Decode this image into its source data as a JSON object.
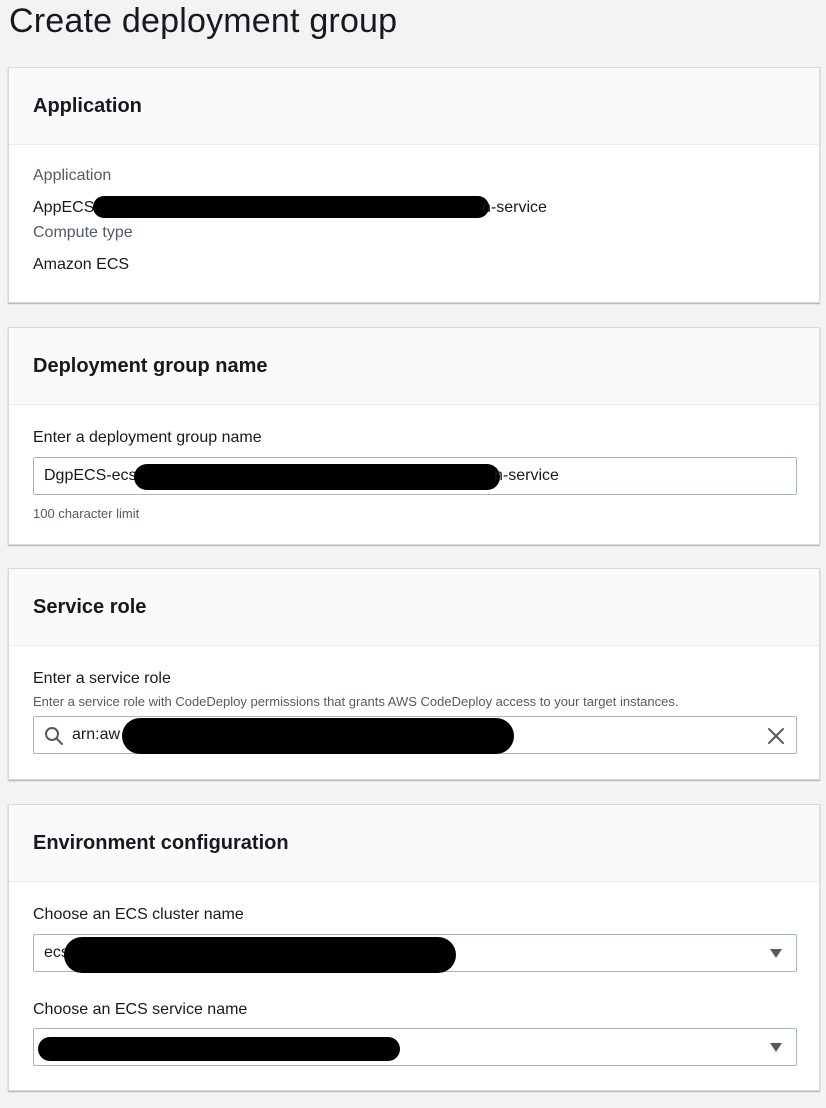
{
  "page": {
    "title": "Create deployment group"
  },
  "application_panel": {
    "header": "Application",
    "app_label": "Application",
    "app_value_prefix": "AppECS",
    "app_value_suffix": "n-service",
    "compute_label": "Compute type",
    "compute_value": "Amazon ECS"
  },
  "deployment_group_panel": {
    "header": "Deployment group name",
    "field_label": "Enter a deployment group name",
    "value_prefix": "DgpECS-ecs",
    "value_suffix": "n-service",
    "hint": "100 character limit"
  },
  "service_role_panel": {
    "header": "Service role",
    "field_label": "Enter a service role",
    "field_description": "Enter a service role with CodeDeploy permissions that grants AWS CodeDeploy access to your target instances.",
    "value_prefix": "arn:aw"
  },
  "environment_panel": {
    "header": "Environment configuration",
    "cluster_label": "Choose an ECS cluster name",
    "cluster_value_prefix": "ecs",
    "service_label": "Choose an ECS service name",
    "service_value": ""
  },
  "icons": {
    "search": "search-icon",
    "clear": "close-icon",
    "dropdown": "caret-down-icon"
  }
}
